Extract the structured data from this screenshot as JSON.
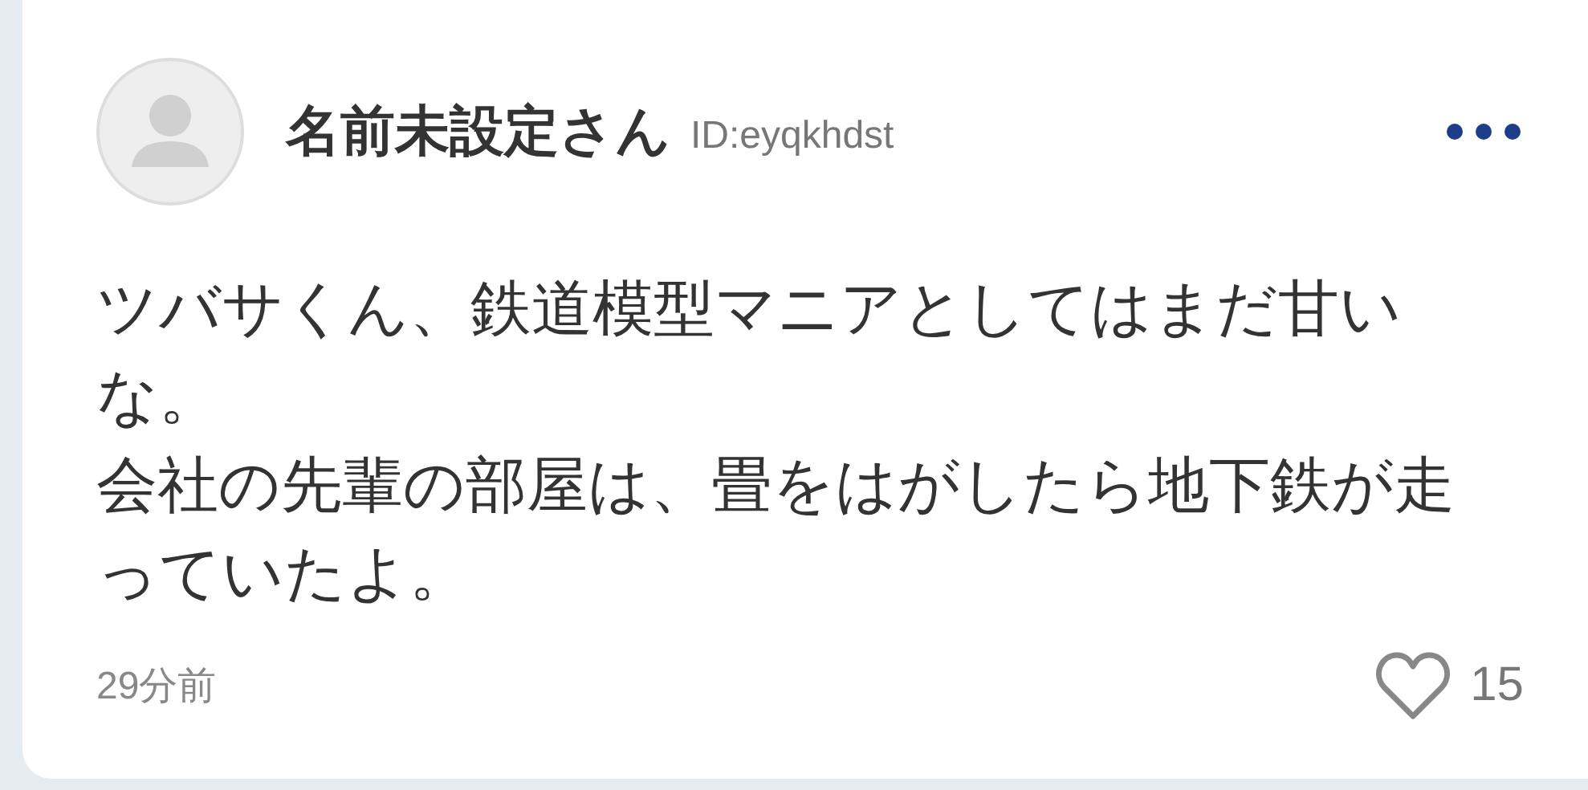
{
  "post": {
    "author": "名前未設定さん",
    "user_id": "ID:eyqkhdst",
    "body": [
      "ツバサくん、鉄道模型マニアとしてはまだ甘いな。",
      "会社の先輩の部屋は、畳をはがしたら地下鉄が走っていたよ。"
    ],
    "time": "29分前",
    "likes": "15",
    "liked": false
  }
}
